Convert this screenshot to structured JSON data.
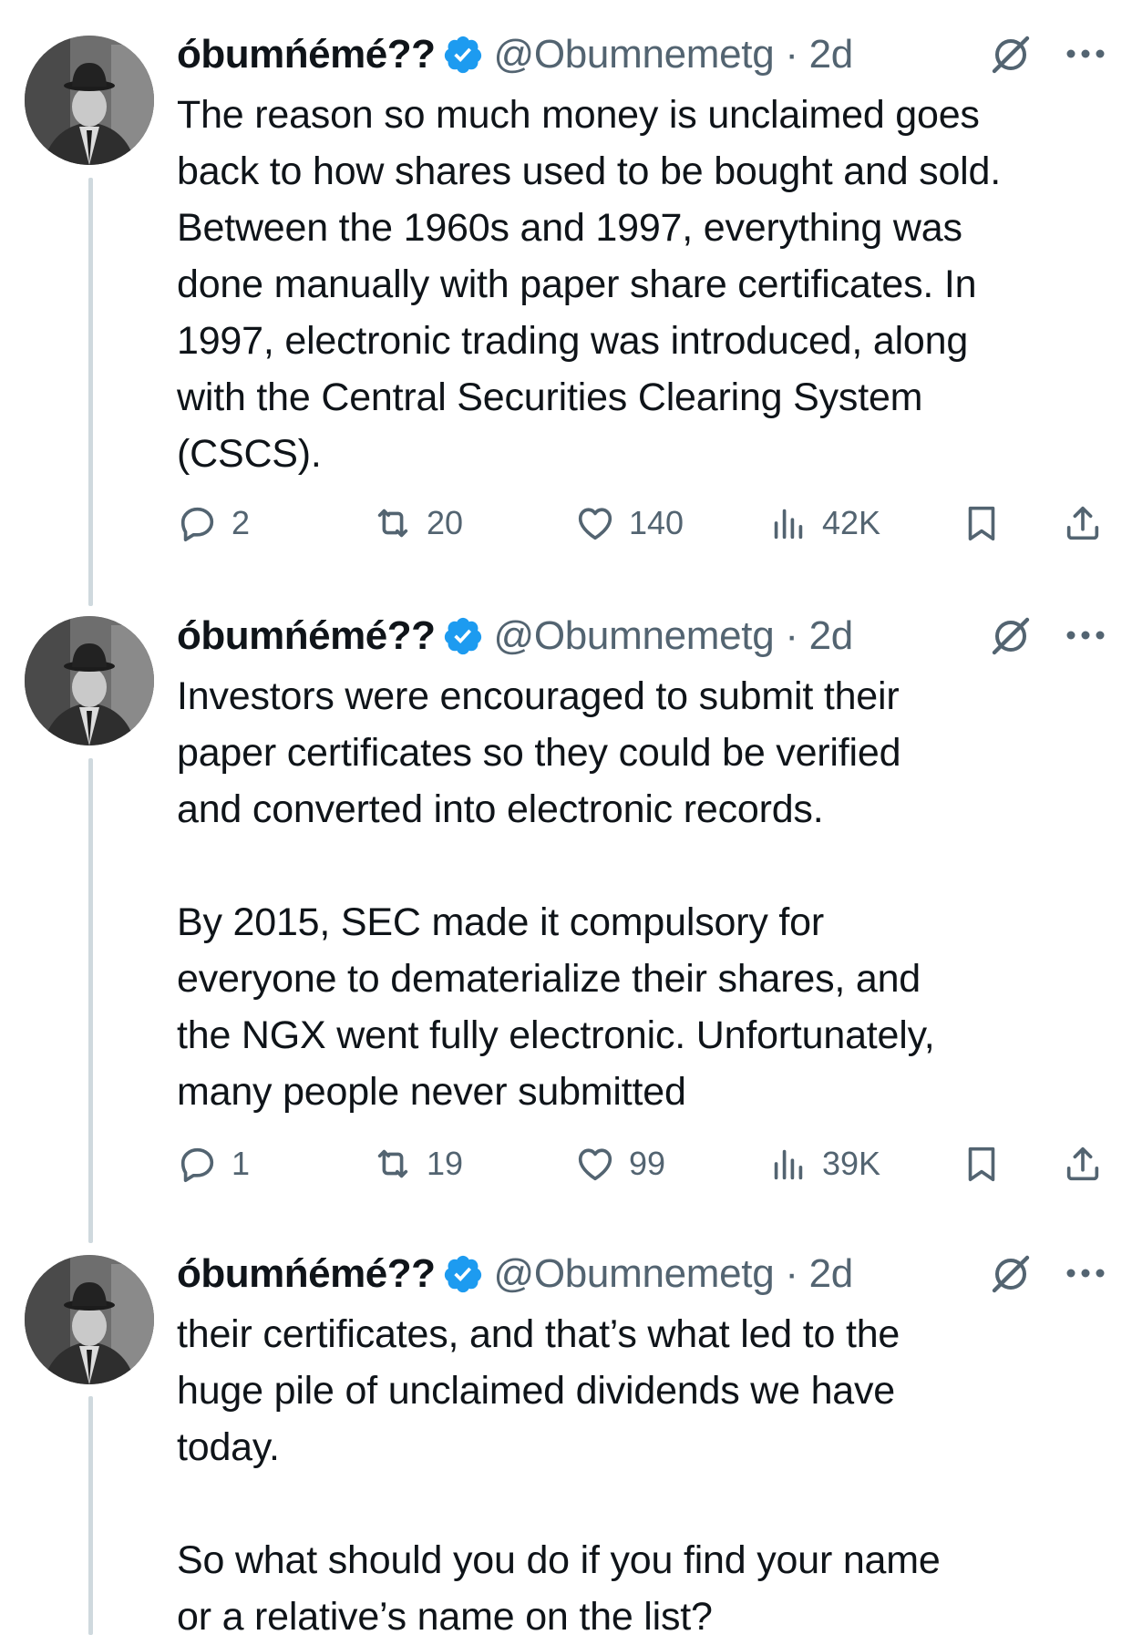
{
  "accent_color": "#1d9bf0",
  "muted_color": "#536471",
  "tweets": [
    {
      "author_name": "óbumńémé??",
      "handle_time": "@Obumnemetg · 2d",
      "verified_icon": "verified-badge-icon",
      "text": "The reason so much money is unclaimed goes\nback to how shares used to be bought and sold.\nBetween the 1960s and 1997, everything was\ndone manually with paper share certificates. In\n1997, electronic trading was introduced, along\nwith the Central Securities Clearing System\n(CSCS).",
      "replies": "2",
      "reposts": "20",
      "likes": "140",
      "views": "42K"
    },
    {
      "author_name": "óbumńémé??",
      "handle_time": "@Obumnemetg · 2d",
      "verified_icon": "verified-badge-icon",
      "text": "Investors were encouraged to submit their\npaper certificates so they could be verified\nand converted into electronic records.\n\nBy 2015, SEC made it compulsory for\neveryone to dematerialize their shares, and\nthe NGX went fully electronic. Unfortunately,\nmany people never submitted",
      "replies": "1",
      "reposts": "19",
      "likes": "99",
      "views": "39K"
    },
    {
      "author_name": "óbumńémé??",
      "handle_time": "@Obumnemetg · 2d",
      "verified_icon": "verified-badge-icon",
      "text": "their certificates, and that’s what led to the\nhuge pile of unclaimed dividends we have\ntoday.\n\nSo what should you do if you find your name\nor a relative’s name on the list?"
    }
  ]
}
